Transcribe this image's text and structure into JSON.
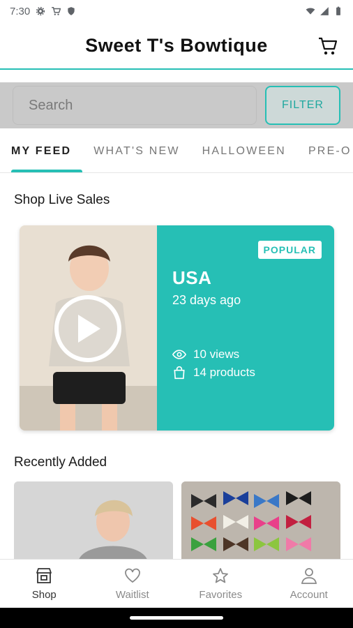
{
  "status_bar": {
    "time": "7:30"
  },
  "header": {
    "title": "Sweet T's Bowtique"
  },
  "search": {
    "placeholder": "Search",
    "filter_label": "FILTER"
  },
  "tabs": [
    {
      "label": "MY FEED",
      "active": true
    },
    {
      "label": "WHAT'S NEW",
      "active": false
    },
    {
      "label": "HALLOWEEN",
      "active": false
    },
    {
      "label": "PRE-O",
      "active": false
    }
  ],
  "live_sales": {
    "section_title": "Shop Live Sales",
    "card": {
      "badge": "POPULAR",
      "title": "USA",
      "date": "23 days ago",
      "views": "10 views",
      "products": "14 products"
    }
  },
  "recently_added": {
    "section_title": "Recently Added"
  },
  "bottom_nav": [
    {
      "label": "Shop",
      "icon": "shop-icon",
      "active": true
    },
    {
      "label": "Waitlist",
      "icon": "heart-icon",
      "active": false
    },
    {
      "label": "Favorites",
      "icon": "star-icon",
      "active": false
    },
    {
      "label": "Account",
      "icon": "account-icon",
      "active": false
    }
  ],
  "colors": {
    "accent": "#26bfb5",
    "search_band": "#c9c9c9"
  }
}
